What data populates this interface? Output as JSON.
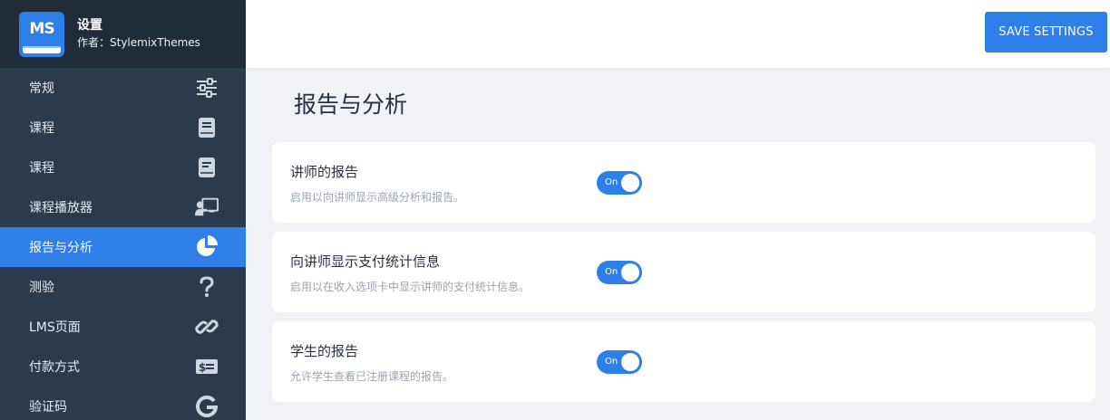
{
  "app": {
    "logo_text": "MS",
    "title": "设置",
    "author": "作者：StylemixThemes"
  },
  "sidebar": {
    "items": [
      {
        "label": "常规",
        "icon": "sliders-icon",
        "active": false
      },
      {
        "label": "课程",
        "icon": "book-icon",
        "active": false
      },
      {
        "label": "课程",
        "icon": "book-open-icon",
        "active": false
      },
      {
        "label": "课程播放器",
        "icon": "chalkboard-teacher-icon",
        "active": false
      },
      {
        "label": "报告与分析",
        "icon": "pie-chart-icon",
        "active": true
      },
      {
        "label": "测验",
        "icon": "question-icon",
        "active": false
      },
      {
        "label": "LMS页面",
        "icon": "link-icon",
        "active": false
      },
      {
        "label": "付款方式",
        "icon": "money-bill-icon",
        "active": false
      },
      {
        "label": "验证码",
        "icon": "google-icon",
        "active": false
      }
    ]
  },
  "toolbar": {
    "save_label": "SAVE SETTINGS"
  },
  "main": {
    "title": "报告与分析",
    "settings": [
      {
        "title": "讲师的报告",
        "description": "启用以向讲师显示高级分析和报告。",
        "toggle_label": "On",
        "enabled": true
      },
      {
        "title": "向讲师显示支付统计信息",
        "description": "启用以在收入选项卡中显示讲师的支付统计信息。",
        "toggle_label": "On",
        "enabled": true
      },
      {
        "title": "学生的报告",
        "description": "允许学生查看已注册课程的报告。",
        "toggle_label": "On",
        "enabled": true
      }
    ]
  },
  "colors": {
    "accent": "#2f7fe8",
    "sidebar_bg": "#2c3a4d",
    "sidebar_head_bg": "#212c39",
    "page_bg": "#f0f2f5"
  }
}
